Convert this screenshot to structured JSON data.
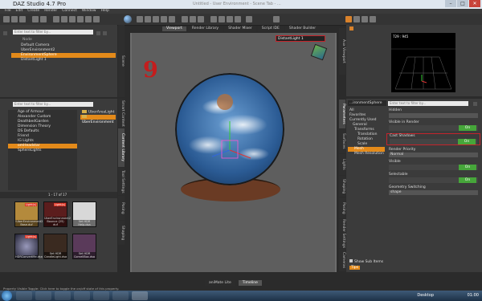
{
  "window": {
    "title": "DAZ Studio 4.7 Pro",
    "center_title": "Untitled - User Environment - Scene Tab - ...",
    "min": "–",
    "max": "□",
    "close": "✕"
  },
  "menu": [
    "File",
    "Edit",
    "Create",
    "Render",
    "Connect",
    "Window",
    "Help"
  ],
  "scene": {
    "filter_placeholder": "Enter text to filter by...",
    "header": "Node",
    "items": [
      {
        "label": "Default Camera",
        "selected": false
      },
      {
        "label": "UberEnvironment2",
        "selected": false
      },
      {
        "label": "EnvironmentSphere",
        "selected": true
      },
      {
        "label": "DistantLight 1",
        "selected": false
      }
    ]
  },
  "content_library": {
    "filter_placeholder": "Enter text to filter by...",
    "folders": [
      {
        "label": "Age of Armour",
        "selected": false
      },
      {
        "label": "Alexander Custom",
        "selected": false
      },
      {
        "label": "DeathbedGarden",
        "selected": false
      },
      {
        "label": "Dimension Theory",
        "selected": false
      },
      {
        "label": "DS Defaults",
        "selected": false
      },
      {
        "label": "Friend",
        "selected": false
      },
      {
        "label": "IG Lights",
        "selected": false
      },
      {
        "label": "omHeadstar",
        "selected": true
      },
      {
        "label": "SphereLights",
        "selected": false
      }
    ],
    "selected_folder": "UberEnvironment",
    "side_folders": [
      "UberAreaLight",
      "UberEnvironment"
    ],
    "page_info": "1 - 17 of 17",
    "thumbnails": [
      {
        "label": "!UberEnvironment2 Base.duf",
        "badge": "Light(s)"
      },
      {
        "label": "UberEnvironment2 Bounce (25) duf",
        "badge": "Light(s)"
      },
      {
        "label": "Set HDR Help.dsa",
        "badge": ""
      },
      {
        "label": "HDRConvertMe.dsa",
        "badge": "Light(s)"
      },
      {
        "label": "Set HDR CandleLight.dsa",
        "badge": ""
      },
      {
        "label": "Set HDR CornellBox.dsa",
        "badge": ""
      }
    ]
  },
  "left_side_tabs": [
    "Scene",
    "Smart Content",
    "Content Library",
    "Render Settings"
  ],
  "left_side_tabs2": [
    "Tool Settings",
    "Posing",
    "Shaping"
  ],
  "viewport_tabs": [
    "Viewport",
    "Render Library",
    "Shader Mixer",
    "Script IDE",
    "Shader Builder"
  ],
  "camera_select": "DistantLight 1",
  "step_number": "9",
  "right_side_tabs": [
    "Parameters",
    "Surfaces",
    "Lights",
    "Shaping",
    "Posing",
    "Render Settings",
    "Cameras"
  ],
  "aux": {
    "info": "729 : 945",
    "tab": "Aux Viewport"
  },
  "parameters": {
    "node_select": "...ironmentSphere",
    "filter_placeholder": "Enter text to filter by...",
    "tree": [
      {
        "label": "All",
        "selected": false
      },
      {
        "label": "Favorites",
        "selected": false
      },
      {
        "label": "Currently Used",
        "selected": false
      },
      {
        "label": "General",
        "selected": false
      },
      {
        "label": "Transforms",
        "selected": false
      },
      {
        "label": "Translation",
        "selected": false
      },
      {
        "label": "Rotation",
        "selected": false
      },
      {
        "label": "Scale",
        "selected": false
      },
      {
        "label": "Mesh",
        "selected": true
      },
      {
        "label": "Mesh Resolution",
        "selected": false
      }
    ],
    "props": [
      {
        "label": "Hidden",
        "type": "dropdown",
        "value": ""
      },
      {
        "label": "Visible in Render",
        "type": "toggle",
        "value": "On"
      },
      {
        "label": "Cast Shadows",
        "type": "toggle",
        "value": "On"
      },
      {
        "label": "Render Priority",
        "type": "dropdown",
        "value": "Normal"
      },
      {
        "label": "Visible",
        "type": "toggle",
        "value": "On"
      },
      {
        "label": "Selectable",
        "type": "toggle",
        "value": "On"
      },
      {
        "label": "Geometry Switching",
        "type": "dropdown",
        "value": "shape"
      }
    ],
    "show_sub_items": "Show Sub Items",
    "tips": "Tips"
  },
  "bottom_tabs": [
    "aniMate Lite",
    "Timeline"
  ],
  "status": "Property Visible Toggle: Click here to toggle the on/off state of this property.",
  "taskbar": {
    "desktop": "Desktop",
    "time": "01:00"
  }
}
